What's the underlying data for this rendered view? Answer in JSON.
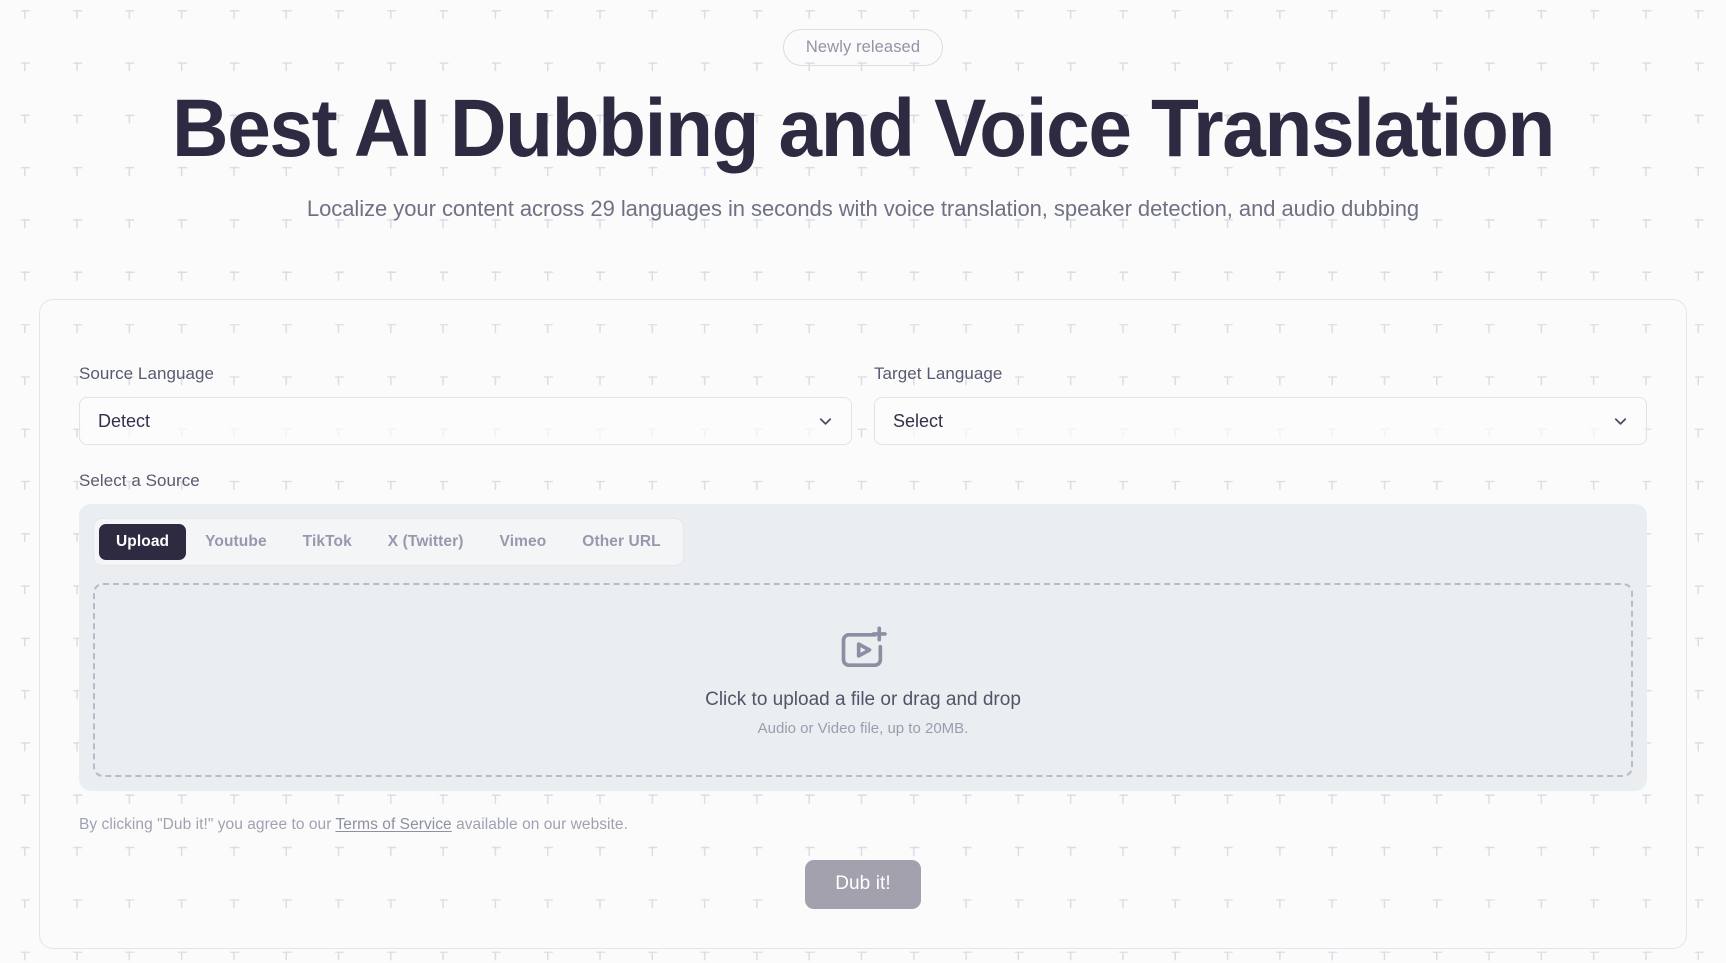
{
  "hero": {
    "badge": "Newly released",
    "title": "Best AI Dubbing and Voice Translation",
    "subtitle": "Localize your content across 29 languages in seconds with voice translation, speaker detection, and audio dubbing"
  },
  "form": {
    "source_language": {
      "label": "Source Language",
      "value": "Detect",
      "icon": "chevron-down-icon"
    },
    "target_language": {
      "label": "Target Language",
      "value": "Select",
      "placeholder": "Select",
      "icon": "chevron-down-icon"
    },
    "source_section_label": "Select a Source",
    "tabs": [
      {
        "label": "Upload",
        "active": true
      },
      {
        "label": "Youtube",
        "active": false
      },
      {
        "label": "TikTok",
        "active": false
      },
      {
        "label": "X (Twitter)",
        "active": false
      },
      {
        "label": "Vimeo",
        "active": false
      },
      {
        "label": "Other URL",
        "active": false
      }
    ],
    "dropzone": {
      "icon": "video-plus-icon",
      "primary_text": "Click to upload a file or drag and drop",
      "secondary_text": "Audio or Video file, up to 20MB."
    }
  },
  "footer": {
    "terms_prefix": "By clicking \"Dub it!\" you agree to our ",
    "terms_link": "Terms of Service",
    "terms_suffix": " available on our website.",
    "submit_label": "Dub it!"
  },
  "colors": {
    "page_background": "#fafbfa",
    "heading": "#2e2a41",
    "muted_text": "#6f7184",
    "accent_dark": "#2e2a41",
    "panel": "#eaeef1",
    "submit_disabled": "#a3a1ae"
  }
}
